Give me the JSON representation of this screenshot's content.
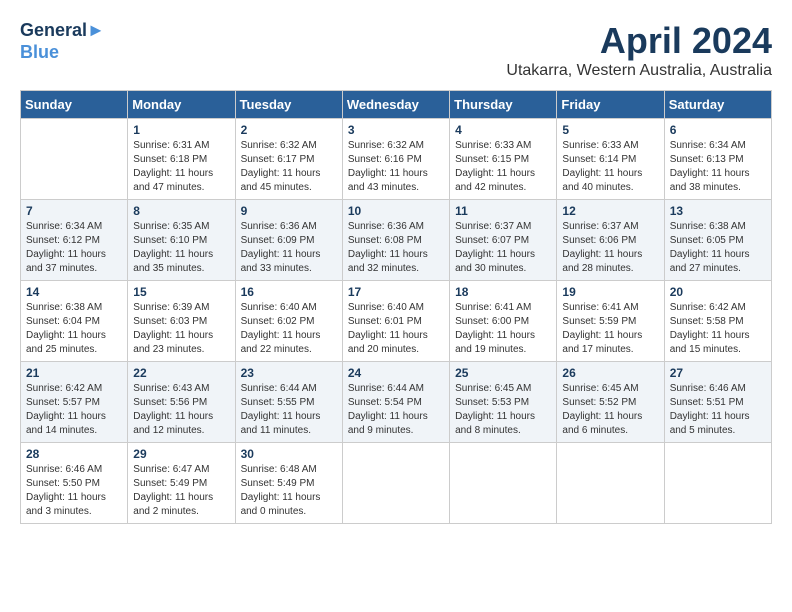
{
  "logo": {
    "line1": "General",
    "line2": "Blue"
  },
  "title": "April 2024",
  "location": "Utakarra, Western Australia, Australia",
  "days_of_week": [
    "Sunday",
    "Monday",
    "Tuesday",
    "Wednesday",
    "Thursday",
    "Friday",
    "Saturday"
  ],
  "weeks": [
    [
      {
        "day": "",
        "sunrise": "",
        "sunset": "",
        "daylight": ""
      },
      {
        "day": "1",
        "sunrise": "Sunrise: 6:31 AM",
        "sunset": "Sunset: 6:18 PM",
        "daylight": "Daylight: 11 hours and 47 minutes."
      },
      {
        "day": "2",
        "sunrise": "Sunrise: 6:32 AM",
        "sunset": "Sunset: 6:17 PM",
        "daylight": "Daylight: 11 hours and 45 minutes."
      },
      {
        "day": "3",
        "sunrise": "Sunrise: 6:32 AM",
        "sunset": "Sunset: 6:16 PM",
        "daylight": "Daylight: 11 hours and 43 minutes."
      },
      {
        "day": "4",
        "sunrise": "Sunrise: 6:33 AM",
        "sunset": "Sunset: 6:15 PM",
        "daylight": "Daylight: 11 hours and 42 minutes."
      },
      {
        "day": "5",
        "sunrise": "Sunrise: 6:33 AM",
        "sunset": "Sunset: 6:14 PM",
        "daylight": "Daylight: 11 hours and 40 minutes."
      },
      {
        "day": "6",
        "sunrise": "Sunrise: 6:34 AM",
        "sunset": "Sunset: 6:13 PM",
        "daylight": "Daylight: 11 hours and 38 minutes."
      }
    ],
    [
      {
        "day": "7",
        "sunrise": "Sunrise: 6:34 AM",
        "sunset": "Sunset: 6:12 PM",
        "daylight": "Daylight: 11 hours and 37 minutes."
      },
      {
        "day": "8",
        "sunrise": "Sunrise: 6:35 AM",
        "sunset": "Sunset: 6:10 PM",
        "daylight": "Daylight: 11 hours and 35 minutes."
      },
      {
        "day": "9",
        "sunrise": "Sunrise: 6:36 AM",
        "sunset": "Sunset: 6:09 PM",
        "daylight": "Daylight: 11 hours and 33 minutes."
      },
      {
        "day": "10",
        "sunrise": "Sunrise: 6:36 AM",
        "sunset": "Sunset: 6:08 PM",
        "daylight": "Daylight: 11 hours and 32 minutes."
      },
      {
        "day": "11",
        "sunrise": "Sunrise: 6:37 AM",
        "sunset": "Sunset: 6:07 PM",
        "daylight": "Daylight: 11 hours and 30 minutes."
      },
      {
        "day": "12",
        "sunrise": "Sunrise: 6:37 AM",
        "sunset": "Sunset: 6:06 PM",
        "daylight": "Daylight: 11 hours and 28 minutes."
      },
      {
        "day": "13",
        "sunrise": "Sunrise: 6:38 AM",
        "sunset": "Sunset: 6:05 PM",
        "daylight": "Daylight: 11 hours and 27 minutes."
      }
    ],
    [
      {
        "day": "14",
        "sunrise": "Sunrise: 6:38 AM",
        "sunset": "Sunset: 6:04 PM",
        "daylight": "Daylight: 11 hours and 25 minutes."
      },
      {
        "day": "15",
        "sunrise": "Sunrise: 6:39 AM",
        "sunset": "Sunset: 6:03 PM",
        "daylight": "Daylight: 11 hours and 23 minutes."
      },
      {
        "day": "16",
        "sunrise": "Sunrise: 6:40 AM",
        "sunset": "Sunset: 6:02 PM",
        "daylight": "Daylight: 11 hours and 22 minutes."
      },
      {
        "day": "17",
        "sunrise": "Sunrise: 6:40 AM",
        "sunset": "Sunset: 6:01 PM",
        "daylight": "Daylight: 11 hours and 20 minutes."
      },
      {
        "day": "18",
        "sunrise": "Sunrise: 6:41 AM",
        "sunset": "Sunset: 6:00 PM",
        "daylight": "Daylight: 11 hours and 19 minutes."
      },
      {
        "day": "19",
        "sunrise": "Sunrise: 6:41 AM",
        "sunset": "Sunset: 5:59 PM",
        "daylight": "Daylight: 11 hours and 17 minutes."
      },
      {
        "day": "20",
        "sunrise": "Sunrise: 6:42 AM",
        "sunset": "Sunset: 5:58 PM",
        "daylight": "Daylight: 11 hours and 15 minutes."
      }
    ],
    [
      {
        "day": "21",
        "sunrise": "Sunrise: 6:42 AM",
        "sunset": "Sunset: 5:57 PM",
        "daylight": "Daylight: 11 hours and 14 minutes."
      },
      {
        "day": "22",
        "sunrise": "Sunrise: 6:43 AM",
        "sunset": "Sunset: 5:56 PM",
        "daylight": "Daylight: 11 hours and 12 minutes."
      },
      {
        "day": "23",
        "sunrise": "Sunrise: 6:44 AM",
        "sunset": "Sunset: 5:55 PM",
        "daylight": "Daylight: 11 hours and 11 minutes."
      },
      {
        "day": "24",
        "sunrise": "Sunrise: 6:44 AM",
        "sunset": "Sunset: 5:54 PM",
        "daylight": "Daylight: 11 hours and 9 minutes."
      },
      {
        "day": "25",
        "sunrise": "Sunrise: 6:45 AM",
        "sunset": "Sunset: 5:53 PM",
        "daylight": "Daylight: 11 hours and 8 minutes."
      },
      {
        "day": "26",
        "sunrise": "Sunrise: 6:45 AM",
        "sunset": "Sunset: 5:52 PM",
        "daylight": "Daylight: 11 hours and 6 minutes."
      },
      {
        "day": "27",
        "sunrise": "Sunrise: 6:46 AM",
        "sunset": "Sunset: 5:51 PM",
        "daylight": "Daylight: 11 hours and 5 minutes."
      }
    ],
    [
      {
        "day": "28",
        "sunrise": "Sunrise: 6:46 AM",
        "sunset": "Sunset: 5:50 PM",
        "daylight": "Daylight: 11 hours and 3 minutes."
      },
      {
        "day": "29",
        "sunrise": "Sunrise: 6:47 AM",
        "sunset": "Sunset: 5:49 PM",
        "daylight": "Daylight: 11 hours and 2 minutes."
      },
      {
        "day": "30",
        "sunrise": "Sunrise: 6:48 AM",
        "sunset": "Sunset: 5:49 PM",
        "daylight": "Daylight: 11 hours and 0 minutes."
      },
      {
        "day": "",
        "sunrise": "",
        "sunset": "",
        "daylight": ""
      },
      {
        "day": "",
        "sunrise": "",
        "sunset": "",
        "daylight": ""
      },
      {
        "day": "",
        "sunrise": "",
        "sunset": "",
        "daylight": ""
      },
      {
        "day": "",
        "sunrise": "",
        "sunset": "",
        "daylight": ""
      }
    ]
  ]
}
